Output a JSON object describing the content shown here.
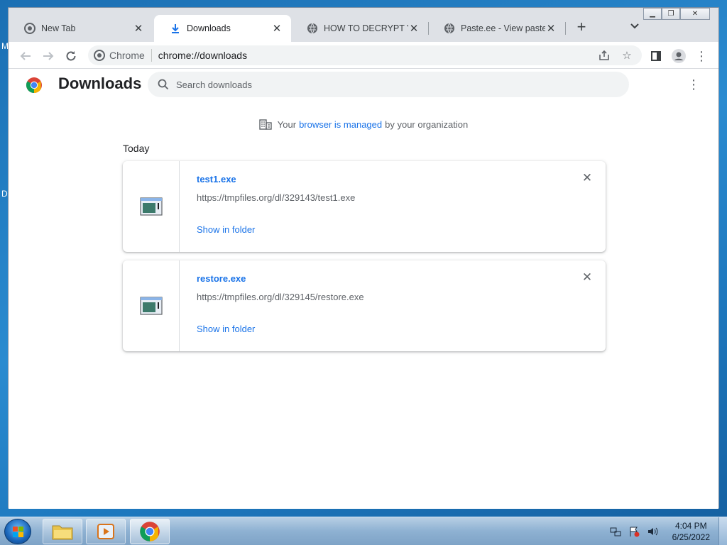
{
  "window": {
    "tabs": [
      {
        "title": "New Tab",
        "icon": "chrome-icon",
        "active": false
      },
      {
        "title": "Downloads",
        "icon": "download-icon",
        "active": true
      },
      {
        "title": "HOW TO DECRYPT YOU",
        "icon": "globe-icon",
        "active": false
      },
      {
        "title": "Paste.ee - View paste rx",
        "icon": "globe-icon",
        "active": false
      }
    ],
    "tab_close_glyph": "✕",
    "new_tab_glyph": "+"
  },
  "toolbar": {
    "omnibox_chip": "Chrome",
    "omnibox_url": "chrome://downloads"
  },
  "downloads": {
    "title": "Downloads",
    "search_placeholder": "Search downloads",
    "managed_prefix": "Your",
    "managed_link": "browser is managed",
    "managed_suffix": "by your organization",
    "section": "Today",
    "items": [
      {
        "file": "test1.exe",
        "url": "https://tmpfiles.org/dl/329143/test1.exe",
        "action": "Show in folder"
      },
      {
        "file": "restore.exe",
        "url": "https://tmpfiles.org/dl/329145/restore.exe",
        "action": "Show in folder"
      }
    ]
  },
  "taskbar": {
    "time": "4:04 PM",
    "date": "6/25/2022"
  },
  "desktop": {
    "fragment_1": "M",
    "fragment_2": "D"
  },
  "colors": {
    "link": "#1a73e8",
    "tabstrip": "#dee1e6",
    "desktop": "#1d77bd"
  }
}
